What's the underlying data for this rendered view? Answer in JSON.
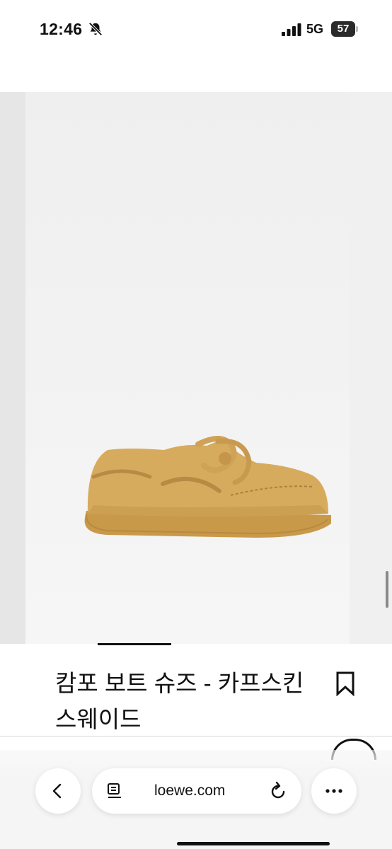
{
  "status_bar": {
    "time": "12:46",
    "network": "5G",
    "battery": "57",
    "icons": [
      "bell-slash-icon",
      "signal-icon",
      "battery-icon"
    ]
  },
  "product": {
    "title": "캄포 보트 슈즈 - 카프스킨 스웨이드",
    "image_alt": "shoe-image",
    "colors": {
      "shoe": "#d4a85a",
      "background": "#f1f1f1"
    }
  },
  "browser": {
    "url": "loewe.com",
    "icons": [
      "chevron-left-icon",
      "reader-icon",
      "reload-icon",
      "more-icon"
    ]
  }
}
